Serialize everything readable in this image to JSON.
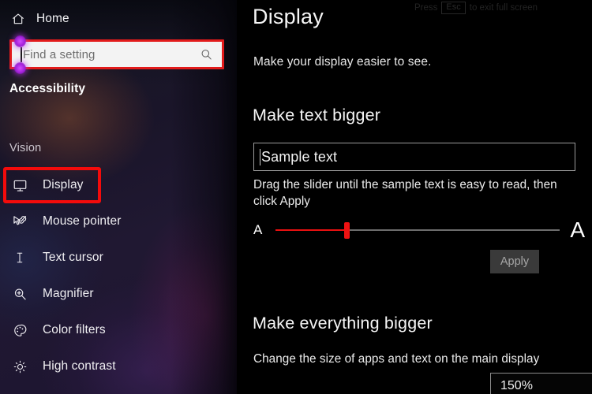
{
  "sidebar": {
    "home": {
      "label": "Home",
      "icon": "home-icon"
    },
    "search": {
      "value": "",
      "placeholder": "Find a setting",
      "icon": "search-icon"
    },
    "app_heading": "Accessibility",
    "group_label": "Vision",
    "items": [
      {
        "label": "Display",
        "icon": "monitor-icon",
        "selected": true
      },
      {
        "label": "Mouse pointer",
        "icon": "mouse-pointer-icon",
        "selected": false
      },
      {
        "label": "Text cursor",
        "icon": "text-cursor-icon",
        "selected": false
      },
      {
        "label": "Magnifier",
        "icon": "magnifier-icon",
        "selected": false
      },
      {
        "label": "Color filters",
        "icon": "color-palette-icon",
        "selected": false
      },
      {
        "label": "High contrast",
        "icon": "brightness-icon",
        "selected": false
      }
    ]
  },
  "main": {
    "esc_hint": {
      "prefix": "Press",
      "key": "Esc",
      "suffix": "to exit full screen"
    },
    "title": "Display",
    "subtitle": "Make your display easier to see.",
    "text_section": {
      "heading": "Make text bigger",
      "sample_text": "Sample text",
      "help": "Drag the slider until the sample text is easy to read, then click Apply",
      "slider": {
        "min_label": "A",
        "max_label": "A",
        "value_percent": 25
      },
      "apply_label": "Apply"
    },
    "scale_section": {
      "heading": "Make everything bigger",
      "help": "Change the size of apps and text on the main display",
      "dropdown_value": "150%",
      "dropdown_icon": "chevron-down-icon"
    }
  },
  "colors": {
    "highlight_red": "#f40b0b",
    "search_border_red": "#e21b1b",
    "slider_red": "#ef1212",
    "selection_handle_purple": "#c23dec",
    "panel_background": "#000000",
    "sidebar_background": "#191a26"
  }
}
